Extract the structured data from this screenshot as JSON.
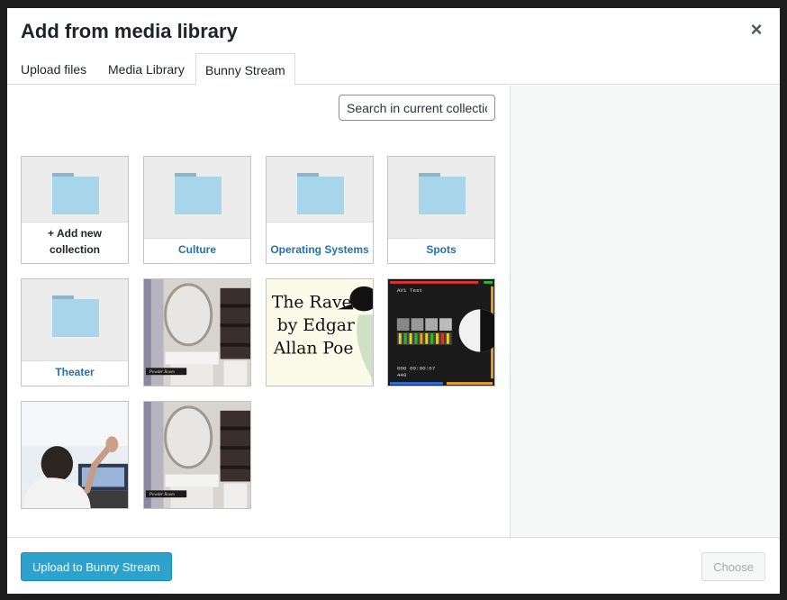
{
  "modal": {
    "title": "Add from media library",
    "close_icon": "close-icon"
  },
  "tabs": [
    {
      "label": "Upload files",
      "active": false
    },
    {
      "label": "Media Library",
      "active": false
    },
    {
      "label": "Bunny Stream",
      "active": true
    }
  ],
  "search": {
    "placeholder": "Search in current collection"
  },
  "collections": [
    {
      "label": "+ Add new collection",
      "icon": "folder-icon"
    },
    {
      "label": "Culture",
      "icon": "folder-icon"
    },
    {
      "label": "Operating Systems",
      "icon": "folder-icon"
    },
    {
      "label": "Spots",
      "icon": "folder-icon"
    },
    {
      "label": "Theater",
      "icon": "folder-icon"
    }
  ],
  "videos": [
    {
      "caption": "Powder Room"
    },
    {
      "text_line1": "The Raven",
      "text_line2": "by Edgar",
      "text_line3": "Allan Poe"
    },
    {
      "title": "AV1 Test",
      "timecode": "000 00:00:07",
      "frame": "449"
    },
    {
      "caption": ""
    },
    {
      "caption": "Powder Room"
    }
  ],
  "footer": {
    "upload_label": "Upload to Bunny Stream",
    "choose_label": "Choose"
  },
  "colors": {
    "accent": "#2ea2cc",
    "link": "#2271b1",
    "folder": "#a7d5ea"
  }
}
